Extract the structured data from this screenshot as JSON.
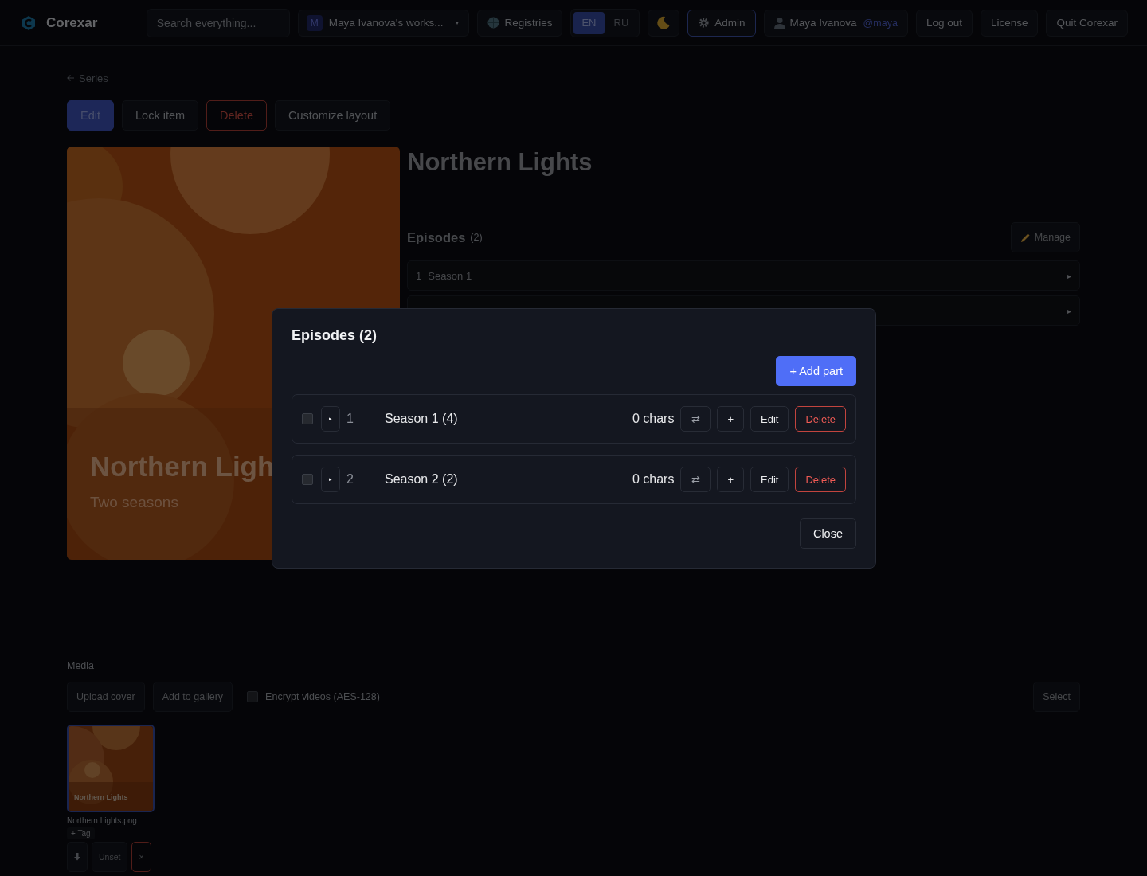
{
  "header": {
    "brand": "Corexar",
    "search": {
      "placeholder": "Search everything..."
    },
    "workspace": {
      "avatar": "M",
      "label": "Maya Ivanova's works...",
      "caret": "▾"
    },
    "registries": "Registries",
    "languages": [
      {
        "label": "EN",
        "selected": true
      },
      {
        "label": "RU",
        "selected": false
      }
    ],
    "admin": "Admin",
    "user": {
      "name": "Maya Ivanova",
      "handle": "@maya"
    },
    "actions": [
      "Log out",
      "License",
      "Quit Corexar"
    ]
  },
  "back": "Series",
  "toolbar": [
    {
      "label": "Edit",
      "kind": "primary"
    },
    {
      "label": "Lock item",
      "kind": "plain"
    },
    {
      "label": "Delete",
      "kind": "danger"
    },
    {
      "label": "Customize layout",
      "kind": "plain"
    }
  ],
  "cover": {
    "title": "Northern Ligh",
    "subtitle": "Two seasons"
  },
  "title": "Northern Lights",
  "episodes": {
    "heading": "Episodes",
    "count": "(2)",
    "manage": "Manage",
    "rows": [
      {
        "kind": "row",
        "number": "1",
        "title": "Season 1",
        "caret": "▸"
      },
      {
        "kind": "covered",
        "caret": "▸"
      }
    ]
  },
  "media": {
    "label": "Media",
    "buttons": [
      "Upload cover",
      "Add to gallery"
    ],
    "encrypt": {
      "label": "Encrypt videos (AES-128)",
      "checked": false
    },
    "select": "Select",
    "items": [
      {
        "caption": "Northern Lights",
        "filename": "Northern Lights.png",
        "tag": "+ Tag",
        "unset": "Unset",
        "remove": "×",
        "selected": true
      }
    ]
  },
  "modal": {
    "title": "Episodes (2)",
    "add": "+ Add part",
    "close": "Close",
    "rows": [
      {
        "checked": false,
        "expand": "▸",
        "number": "1",
        "title": "Season 1 (4)",
        "chars": "0 chars",
        "swap": "⇄",
        "plus": "+",
        "edit": "Edit",
        "delete": "Delete"
      },
      {
        "checked": false,
        "expand": "▸",
        "number": "2",
        "title": "Season 2 (2)",
        "chars": "0 chars",
        "swap": "⇄",
        "plus": "+",
        "edit": "Edit",
        "delete": "Delete"
      }
    ]
  }
}
